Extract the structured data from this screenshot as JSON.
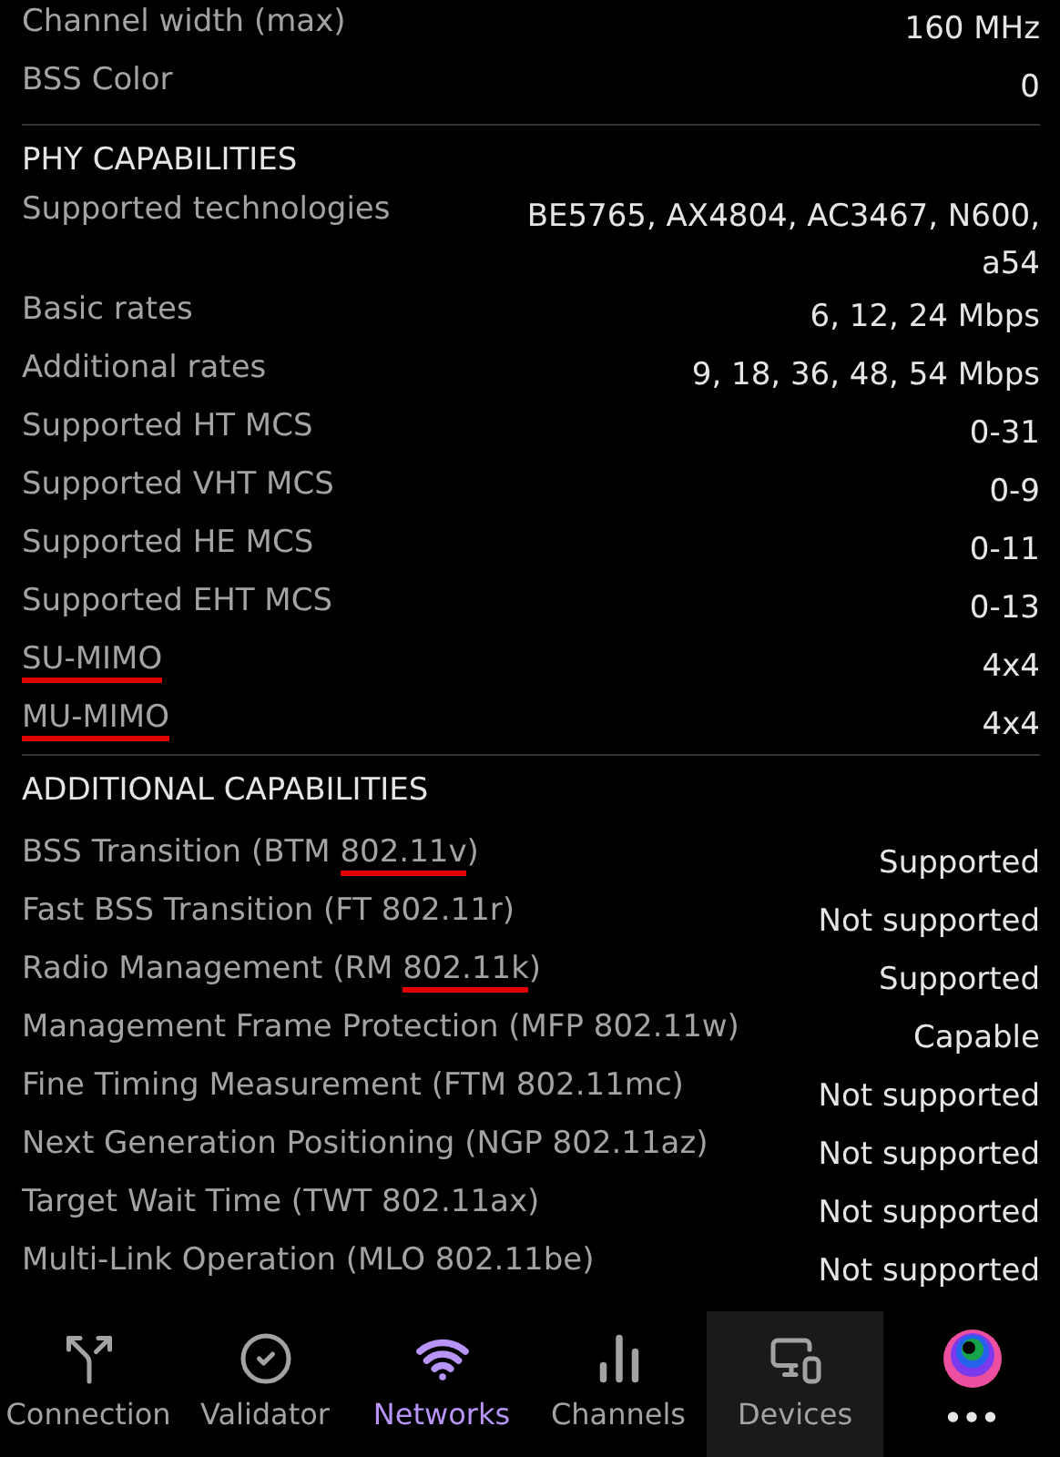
{
  "sections": [
    {
      "rows": [
        {
          "label_parts": [
            {
              "text": "Channel width (max)",
              "underlined": false
            }
          ],
          "value": "160 MHz"
        },
        {
          "label_parts": [
            {
              "text": "BSS Color",
              "underlined": false
            }
          ],
          "value": "0"
        }
      ]
    },
    {
      "title": "PHY CAPABILITIES",
      "rows": [
        {
          "label_parts": [
            {
              "text": "Supported technologies",
              "underlined": false
            }
          ],
          "value": "BE5765, AX4804, AC3467, N600, a54"
        },
        {
          "label_parts": [
            {
              "text": "Basic rates",
              "underlined": false
            }
          ],
          "value": "6, 12, 24 Mbps"
        },
        {
          "label_parts": [
            {
              "text": "Additional rates",
              "underlined": false
            }
          ],
          "value": "9, 18, 36, 48, 54 Mbps"
        },
        {
          "label_parts": [
            {
              "text": "Supported HT MCS",
              "underlined": false
            }
          ],
          "value": "0-31"
        },
        {
          "label_parts": [
            {
              "text": "Supported VHT MCS",
              "underlined": false
            }
          ],
          "value": "0-9"
        },
        {
          "label_parts": [
            {
              "text": "Supported HE MCS",
              "underlined": false
            }
          ],
          "value": "0-11"
        },
        {
          "label_parts": [
            {
              "text": "Supported EHT MCS",
              "underlined": false
            }
          ],
          "value": "0-13"
        },
        {
          "label_parts": [
            {
              "text": "SU-MIMO",
              "underlined": true
            }
          ],
          "value": "4x4"
        },
        {
          "label_parts": [
            {
              "text": "MU-MIMO",
              "underlined": true
            }
          ],
          "value": "4x4"
        }
      ]
    },
    {
      "title": "ADDITIONAL CAPABILITIES",
      "rows": [
        {
          "label_parts": [
            {
              "text": "BSS Transition (BTM ",
              "underlined": false
            },
            {
              "text": "802.11v",
              "underlined": true
            },
            {
              "text": ")",
              "underlined": false
            }
          ],
          "value": "Supported"
        },
        {
          "label_parts": [
            {
              "text": "Fast BSS Transition (FT 802.11r)",
              "underlined": false
            }
          ],
          "value": "Not supported"
        },
        {
          "label_parts": [
            {
              "text": "Radio Management (RM ",
              "underlined": false
            },
            {
              "text": "802.11k",
              "underlined": true
            },
            {
              "text": ")",
              "underlined": false
            }
          ],
          "value": "Supported"
        },
        {
          "label_parts": [
            {
              "text": "Management Frame Protection (MFP 802.11w)",
              "underlined": false
            }
          ],
          "value": "Capable"
        },
        {
          "label_parts": [
            {
              "text": "Fine Timing Measurement (FTM 802.11mc)",
              "underlined": false
            }
          ],
          "value": "Not supported"
        },
        {
          "label_parts": [
            {
              "text": "Next Generation Positioning (NGP 802.11az)",
              "underlined": false
            }
          ],
          "value": "Not supported"
        },
        {
          "label_parts": [
            {
              "text": "Target Wait Time (TWT 802.11ax)",
              "underlined": false
            }
          ],
          "value": "Not supported"
        },
        {
          "label_parts": [
            {
              "text": "Multi-Link Operation (MLO 802.11be)",
              "underlined": false
            }
          ],
          "value": "Not supported"
        }
      ]
    }
  ],
  "nav": [
    {
      "kind": "connection",
      "label": "Connection",
      "selected": false,
      "highlighted": false
    },
    {
      "kind": "validator",
      "label": "Validator",
      "selected": false,
      "highlighted": false
    },
    {
      "kind": "networks",
      "label": "Networks",
      "selected": true,
      "highlighted": false
    },
    {
      "kind": "channels",
      "label": "Channels",
      "selected": false,
      "highlighted": false
    },
    {
      "kind": "devices",
      "label": "Devices",
      "selected": false,
      "highlighted": true
    },
    {
      "kind": "more",
      "label": "•••",
      "selected": false,
      "highlighted": false
    }
  ]
}
